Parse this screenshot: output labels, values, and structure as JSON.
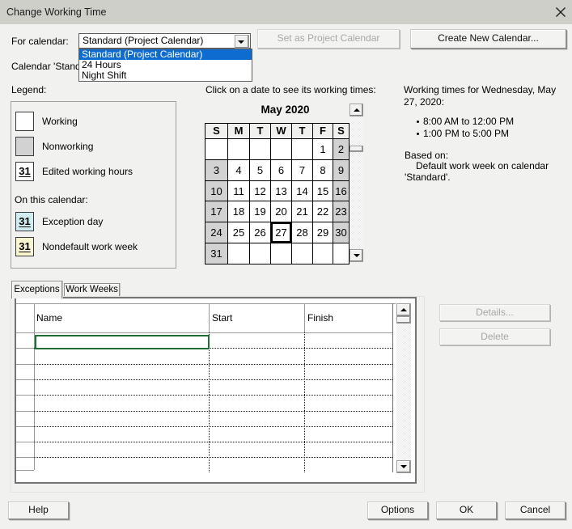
{
  "window": {
    "title": "Change Working Time"
  },
  "for_calendar": {
    "label": "For calendar:",
    "value": "Standard (Project Calendar)",
    "options": [
      "Standard (Project Calendar)",
      "24 Hours",
      "Night Shift"
    ],
    "selected_index": 0
  },
  "base_calendar_note": "Calendar 'Standard' is a base calendar.",
  "buttons": {
    "set_as_project": "Set as Project Calendar",
    "create_new": "Create New Calendar...",
    "details": "Details...",
    "delete": "Delete",
    "help": "Help",
    "options": "Options",
    "ok": "OK",
    "cancel": "Cancel"
  },
  "legend": {
    "label": "Legend:",
    "working": "Working",
    "nonworking": "Nonworking",
    "edited": "Edited working hours",
    "on_this_calendar": "On this calendar:",
    "exception": "Exception day",
    "nondefault": "Nondefault work week",
    "swatch_number": "31"
  },
  "calendar": {
    "hint": "Click on a date to see its working times:",
    "month_title": "May 2020",
    "day_headers": [
      "S",
      "M",
      "T",
      "W",
      "T",
      "F",
      "S"
    ],
    "weeks": [
      [
        "",
        "",
        "",
        "",
        "",
        "1",
        "2"
      ],
      [
        "3",
        "4",
        "5",
        "6",
        "7",
        "8",
        "9"
      ],
      [
        "10",
        "11",
        "12",
        "13",
        "14",
        "15",
        "16"
      ],
      [
        "17",
        "18",
        "19",
        "20",
        "21",
        "22",
        "23"
      ],
      [
        "24",
        "25",
        "26",
        "27",
        "28",
        "29",
        "30"
      ],
      [
        "31",
        "",
        "",
        "",
        "",
        "",
        ""
      ]
    ],
    "selected_day": "27"
  },
  "working_times": {
    "heading": "Working times for Wednesday, May 27, 2020:",
    "times": [
      "8:00 AM to 12:00 PM",
      "1:00 PM to 5:00 PM"
    ],
    "based_on_label": "Based on:",
    "based_on_text": "Default work week on calendar 'Standard'."
  },
  "tabs": {
    "exceptions": "Exceptions",
    "work_weeks": "Work Weeks"
  },
  "exceptions_table": {
    "columns": [
      "Name",
      "Start",
      "Finish"
    ],
    "visible_rows": 9
  },
  "colors": {
    "selection_blue": "#0e6cd0",
    "selection_green": "#1e7034",
    "titlebar": "#cfcfca",
    "dialog_bg": "#f1f1f0"
  }
}
